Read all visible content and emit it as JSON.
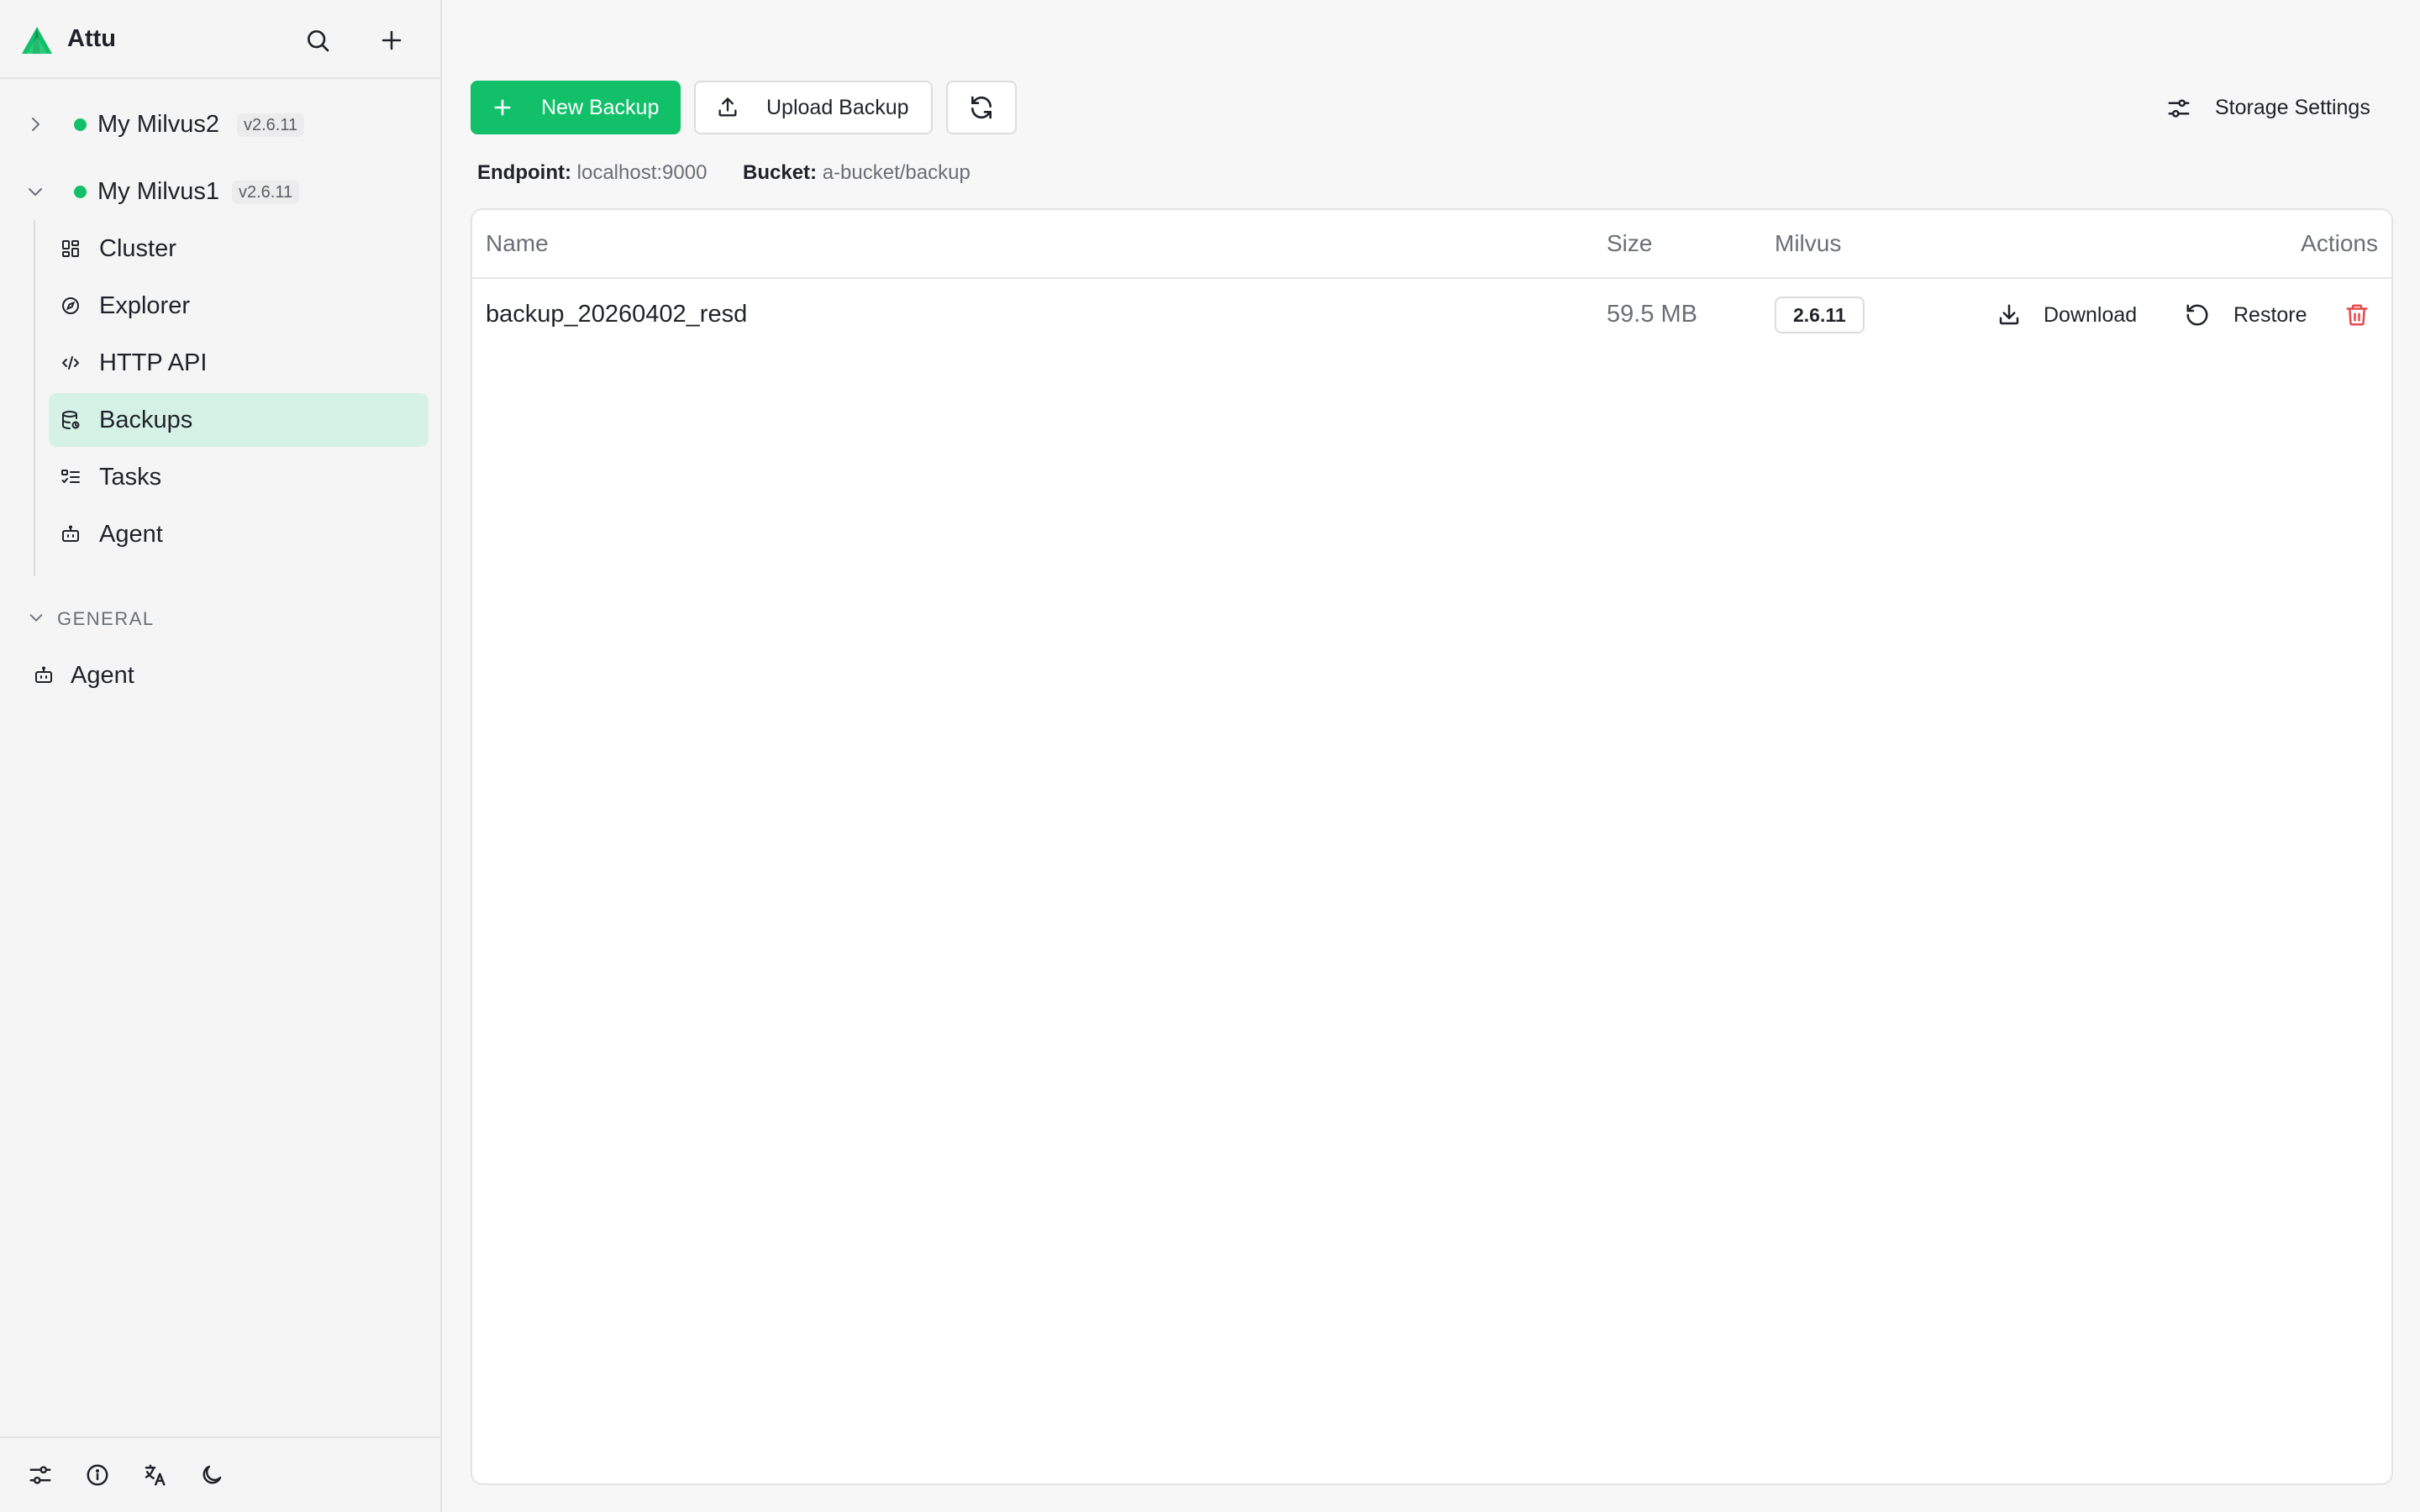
{
  "app": {
    "title": "Attu"
  },
  "colors": {
    "accent": "#12c06a",
    "danger": "#e5484d",
    "active_nav_bg": "#d6f2e7"
  },
  "sidebar": {
    "connections": [
      {
        "name": "My Milvus2",
        "version": "v2.6.11",
        "status": "online",
        "expanded": false
      },
      {
        "name": "My Milvus1",
        "version": "v2.6.11",
        "status": "online",
        "expanded": true
      }
    ],
    "nav": [
      {
        "label": "Cluster",
        "icon": "grid-icon"
      },
      {
        "label": "Explorer",
        "icon": "compass-icon"
      },
      {
        "label": "HTTP API",
        "icon": "code-icon"
      },
      {
        "label": "Backups",
        "icon": "database-backup-icon",
        "active": true
      },
      {
        "label": "Tasks",
        "icon": "list-checks-icon"
      },
      {
        "label": "Agent",
        "icon": "bot-icon"
      }
    ],
    "general": {
      "label": "GENERAL",
      "items": [
        {
          "label": "Agent",
          "icon": "bot-icon"
        }
      ]
    },
    "footer_icons": [
      "settings-sliders-icon",
      "info-icon",
      "translate-icon",
      "moon-icon"
    ]
  },
  "toolbar": {
    "new_backup": "New Backup",
    "upload_backup": "Upload Backup",
    "storage_settings": "Storage Settings"
  },
  "storage_meta": {
    "endpoint_label": "Endpoint:",
    "endpoint_value": "localhost:9000",
    "bucket_label": "Bucket:",
    "bucket_value": "a-bucket/backup"
  },
  "table": {
    "columns": [
      "Name",
      "Size",
      "Milvus",
      "Actions"
    ],
    "rows": [
      {
        "name": "backup_20260402_resd",
        "size": "59.5 MB",
        "milvus": "2.6.11",
        "download": "Download",
        "restore": "Restore"
      }
    ]
  }
}
